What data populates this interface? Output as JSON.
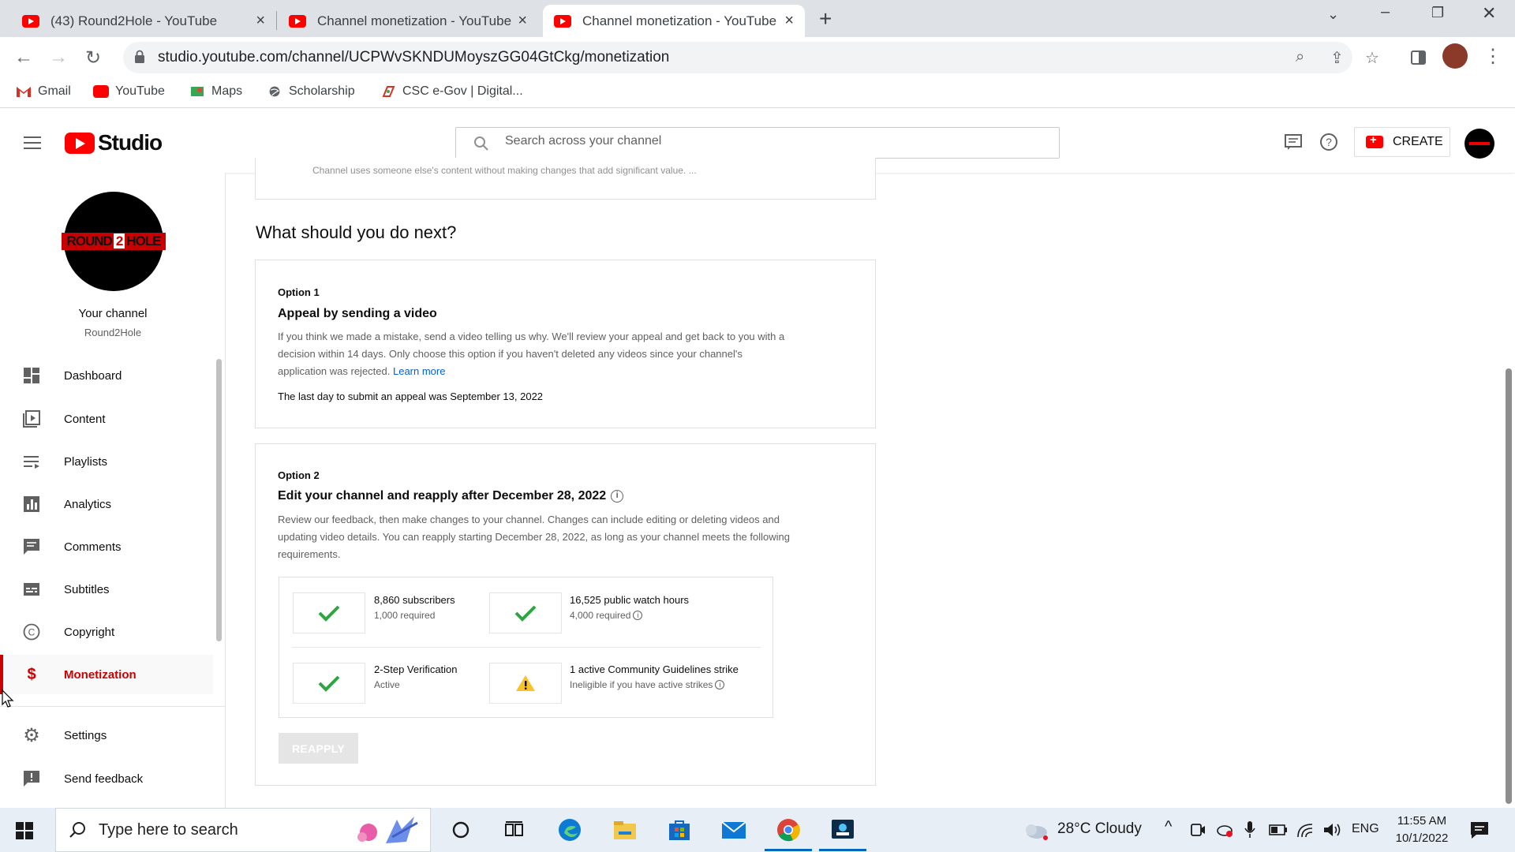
{
  "browser": {
    "tabs": [
      {
        "title": "(43) Round2Hole - YouTube"
      },
      {
        "title": "Channel monetization - YouTube"
      },
      {
        "title": "Channel monetization - YouTube"
      }
    ],
    "url": "studio.youtube.com/channel/UCPWvSKNDUMoyszGG04GtCkg/monetization",
    "bookmarks": [
      "Gmail",
      "YouTube",
      "Maps",
      "Scholarship",
      "CSC e-Gov | Digital..."
    ]
  },
  "header": {
    "logo_text": "Studio",
    "search_placeholder": "Search across your channel",
    "create_label": "CREATE"
  },
  "sidebar": {
    "avatar_text_left": "ROUND",
    "avatar_text_mid": "2",
    "avatar_text_right": "HOLE",
    "channel_title": "Your channel",
    "channel_name": "Round2Hole",
    "items": [
      {
        "label": "Dashboard",
        "icon": "dashboard-icon"
      },
      {
        "label": "Content",
        "icon": "content-icon"
      },
      {
        "label": "Playlists",
        "icon": "playlists-icon"
      },
      {
        "label": "Analytics",
        "icon": "analytics-icon"
      },
      {
        "label": "Comments",
        "icon": "comments-icon"
      },
      {
        "label": "Subtitles",
        "icon": "subtitles-icon"
      },
      {
        "label": "Copyright",
        "icon": "copyright-icon"
      },
      {
        "label": "Monetization",
        "icon": "dollar-icon",
        "active": true
      },
      {
        "label": "Settings",
        "icon": "gear-icon"
      },
      {
        "label": "Send feedback",
        "icon": "feedback-icon"
      }
    ]
  },
  "main": {
    "truncated_text": "Channel uses someone else's content without making changes that add significant value. ...",
    "heading": "What should you do next?",
    "option1": {
      "label": "Option 1",
      "title": "Appeal by sending a video",
      "body_line1": "If you think we made a mistake, send a video telling us why. We'll review your appeal and get back to you with a",
      "body_line2": "decision within 14 days. Only choose this option if you haven't deleted any videos since your channel's",
      "body_line3": "application was rejected.",
      "learn_more": "Learn more",
      "last_day": "The last day to submit an appeal was September 13, 2022"
    },
    "option2": {
      "label": "Option 2",
      "title": "Edit your channel and reapply after December 28, 2022",
      "body_line1": "Review our feedback, then make changes to your channel. Changes can include editing or deleting videos and",
      "body_line2": "updating video details. You can reapply starting December 28, 2022, as long as your channel meets the following",
      "body_line3": "requirements.",
      "requirements": [
        {
          "title": "8,860 subscribers",
          "sub": "1,000 required",
          "status": "met"
        },
        {
          "title": "16,525 public watch hours",
          "sub": "4,000 required",
          "status": "met"
        },
        {
          "title": "2-Step Verification",
          "sub": "Active",
          "status": "met"
        },
        {
          "title": "1 active Community Guidelines strike",
          "sub": "Ineligible if you have active strikes",
          "status": "warning"
        }
      ],
      "reapply_label": "REAPPLY"
    }
  },
  "taskbar": {
    "search_placeholder": "Type here to search",
    "weather": "28°C  Cloudy",
    "language": "ENG",
    "time": "11:55 AM",
    "date": "10/1/2022"
  },
  "colors": {
    "accent_red": "#cc0000",
    "link_blue": "#065fd4",
    "check_green": "#2ba640",
    "warning_yellow": "#f9c22b"
  }
}
